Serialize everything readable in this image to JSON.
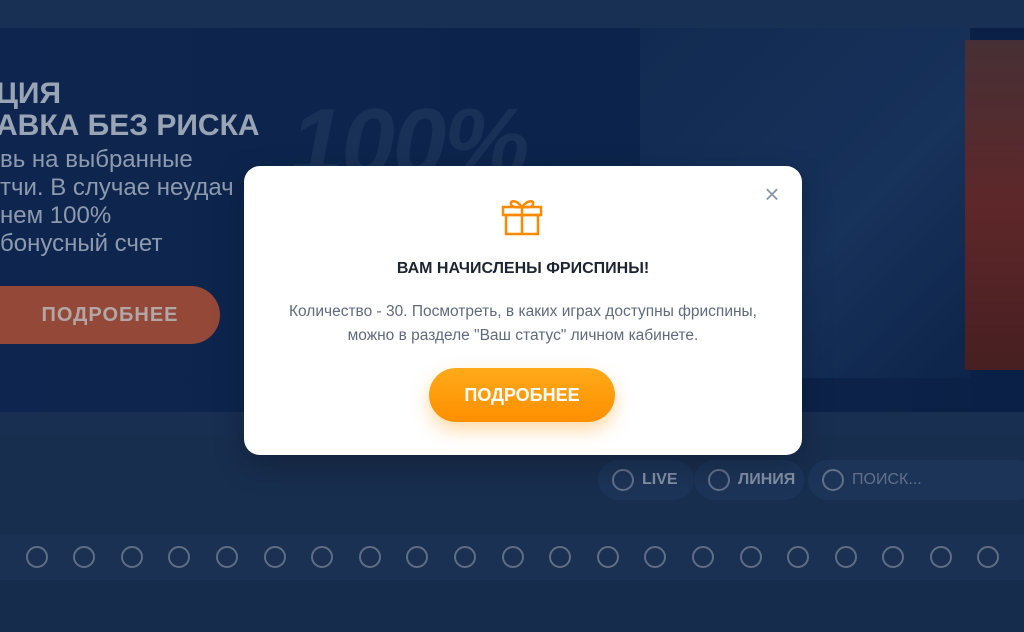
{
  "banner": {
    "title_lines": [
      "ЦИЯ",
      "АВКА БЕЗ РИСКА"
    ],
    "text_lines": [
      "вь на выбранные",
      "тчи. В случае неудач",
      "нем 100%",
      "бонусный счет"
    ],
    "big_text": "100%",
    "button": "ПОДРОБНЕЕ"
  },
  "filters": {
    "live": "LIVE",
    "line": "ЛИНИЯ",
    "search_placeholder": "ПОИСК..."
  },
  "sports_icons": [
    "basketball-icon",
    "hockey-puck-icon",
    "basketball-icon",
    "goal-icon",
    "futsal-icon",
    "volleyball-icon",
    "handball-icon",
    "tennis-icon",
    "tennis-racket-icon",
    "boxing-icon",
    "badminton-icon",
    "american-football-icon",
    "baseball-icon",
    "rugby-icon",
    "racing-flag-icon",
    "rugby-ball-icon",
    "shuttlecock-icon",
    "ball-icon",
    "chess-icon",
    "darts-icon",
    "golf-icon"
  ],
  "modal": {
    "title": "ВАМ НАЧИСЛЕНЫ ФРИСПИНЫ!",
    "text": "Количество - 30. Посмотреть, в каких играх доступны фриспины, можно в разделе \"Ваш статус\" личном кабинете.",
    "button": "ПОДРОБНЕЕ",
    "close_icon": "close-icon",
    "gift_icon": "gift-icon",
    "accent": "#ff9a00"
  }
}
